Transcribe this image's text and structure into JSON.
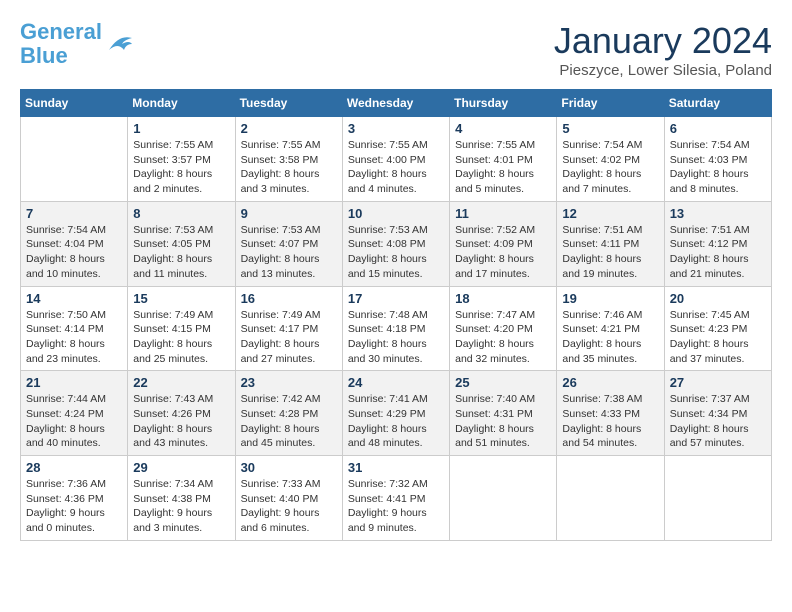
{
  "header": {
    "logo_line1": "General",
    "logo_line2": "Blue",
    "month": "January 2024",
    "location": "Pieszyce, Lower Silesia, Poland"
  },
  "weekdays": [
    "Sunday",
    "Monday",
    "Tuesday",
    "Wednesday",
    "Thursday",
    "Friday",
    "Saturday"
  ],
  "weeks": [
    [
      {
        "day": "",
        "info": ""
      },
      {
        "day": "1",
        "info": "Sunrise: 7:55 AM\nSunset: 3:57 PM\nDaylight: 8 hours\nand 2 minutes."
      },
      {
        "day": "2",
        "info": "Sunrise: 7:55 AM\nSunset: 3:58 PM\nDaylight: 8 hours\nand 3 minutes."
      },
      {
        "day": "3",
        "info": "Sunrise: 7:55 AM\nSunset: 4:00 PM\nDaylight: 8 hours\nand 4 minutes."
      },
      {
        "day": "4",
        "info": "Sunrise: 7:55 AM\nSunset: 4:01 PM\nDaylight: 8 hours\nand 5 minutes."
      },
      {
        "day": "5",
        "info": "Sunrise: 7:54 AM\nSunset: 4:02 PM\nDaylight: 8 hours\nand 7 minutes."
      },
      {
        "day": "6",
        "info": "Sunrise: 7:54 AM\nSunset: 4:03 PM\nDaylight: 8 hours\nand 8 minutes."
      }
    ],
    [
      {
        "day": "7",
        "info": "Sunrise: 7:54 AM\nSunset: 4:04 PM\nDaylight: 8 hours\nand 10 minutes."
      },
      {
        "day": "8",
        "info": "Sunrise: 7:53 AM\nSunset: 4:05 PM\nDaylight: 8 hours\nand 11 minutes."
      },
      {
        "day": "9",
        "info": "Sunrise: 7:53 AM\nSunset: 4:07 PM\nDaylight: 8 hours\nand 13 minutes."
      },
      {
        "day": "10",
        "info": "Sunrise: 7:53 AM\nSunset: 4:08 PM\nDaylight: 8 hours\nand 15 minutes."
      },
      {
        "day": "11",
        "info": "Sunrise: 7:52 AM\nSunset: 4:09 PM\nDaylight: 8 hours\nand 17 minutes."
      },
      {
        "day": "12",
        "info": "Sunrise: 7:51 AM\nSunset: 4:11 PM\nDaylight: 8 hours\nand 19 minutes."
      },
      {
        "day": "13",
        "info": "Sunrise: 7:51 AM\nSunset: 4:12 PM\nDaylight: 8 hours\nand 21 minutes."
      }
    ],
    [
      {
        "day": "14",
        "info": "Sunrise: 7:50 AM\nSunset: 4:14 PM\nDaylight: 8 hours\nand 23 minutes."
      },
      {
        "day": "15",
        "info": "Sunrise: 7:49 AM\nSunset: 4:15 PM\nDaylight: 8 hours\nand 25 minutes."
      },
      {
        "day": "16",
        "info": "Sunrise: 7:49 AM\nSunset: 4:17 PM\nDaylight: 8 hours\nand 27 minutes."
      },
      {
        "day": "17",
        "info": "Sunrise: 7:48 AM\nSunset: 4:18 PM\nDaylight: 8 hours\nand 30 minutes."
      },
      {
        "day": "18",
        "info": "Sunrise: 7:47 AM\nSunset: 4:20 PM\nDaylight: 8 hours\nand 32 minutes."
      },
      {
        "day": "19",
        "info": "Sunrise: 7:46 AM\nSunset: 4:21 PM\nDaylight: 8 hours\nand 35 minutes."
      },
      {
        "day": "20",
        "info": "Sunrise: 7:45 AM\nSunset: 4:23 PM\nDaylight: 8 hours\nand 37 minutes."
      }
    ],
    [
      {
        "day": "21",
        "info": "Sunrise: 7:44 AM\nSunset: 4:24 PM\nDaylight: 8 hours\nand 40 minutes."
      },
      {
        "day": "22",
        "info": "Sunrise: 7:43 AM\nSunset: 4:26 PM\nDaylight: 8 hours\nand 43 minutes."
      },
      {
        "day": "23",
        "info": "Sunrise: 7:42 AM\nSunset: 4:28 PM\nDaylight: 8 hours\nand 45 minutes."
      },
      {
        "day": "24",
        "info": "Sunrise: 7:41 AM\nSunset: 4:29 PM\nDaylight: 8 hours\nand 48 minutes."
      },
      {
        "day": "25",
        "info": "Sunrise: 7:40 AM\nSunset: 4:31 PM\nDaylight: 8 hours\nand 51 minutes."
      },
      {
        "day": "26",
        "info": "Sunrise: 7:38 AM\nSunset: 4:33 PM\nDaylight: 8 hours\nand 54 minutes."
      },
      {
        "day": "27",
        "info": "Sunrise: 7:37 AM\nSunset: 4:34 PM\nDaylight: 8 hours\nand 57 minutes."
      }
    ],
    [
      {
        "day": "28",
        "info": "Sunrise: 7:36 AM\nSunset: 4:36 PM\nDaylight: 9 hours\nand 0 minutes."
      },
      {
        "day": "29",
        "info": "Sunrise: 7:34 AM\nSunset: 4:38 PM\nDaylight: 9 hours\nand 3 minutes."
      },
      {
        "day": "30",
        "info": "Sunrise: 7:33 AM\nSunset: 4:40 PM\nDaylight: 9 hours\nand 6 minutes."
      },
      {
        "day": "31",
        "info": "Sunrise: 7:32 AM\nSunset: 4:41 PM\nDaylight: 9 hours\nand 9 minutes."
      },
      {
        "day": "",
        "info": ""
      },
      {
        "day": "",
        "info": ""
      },
      {
        "day": "",
        "info": ""
      }
    ]
  ]
}
